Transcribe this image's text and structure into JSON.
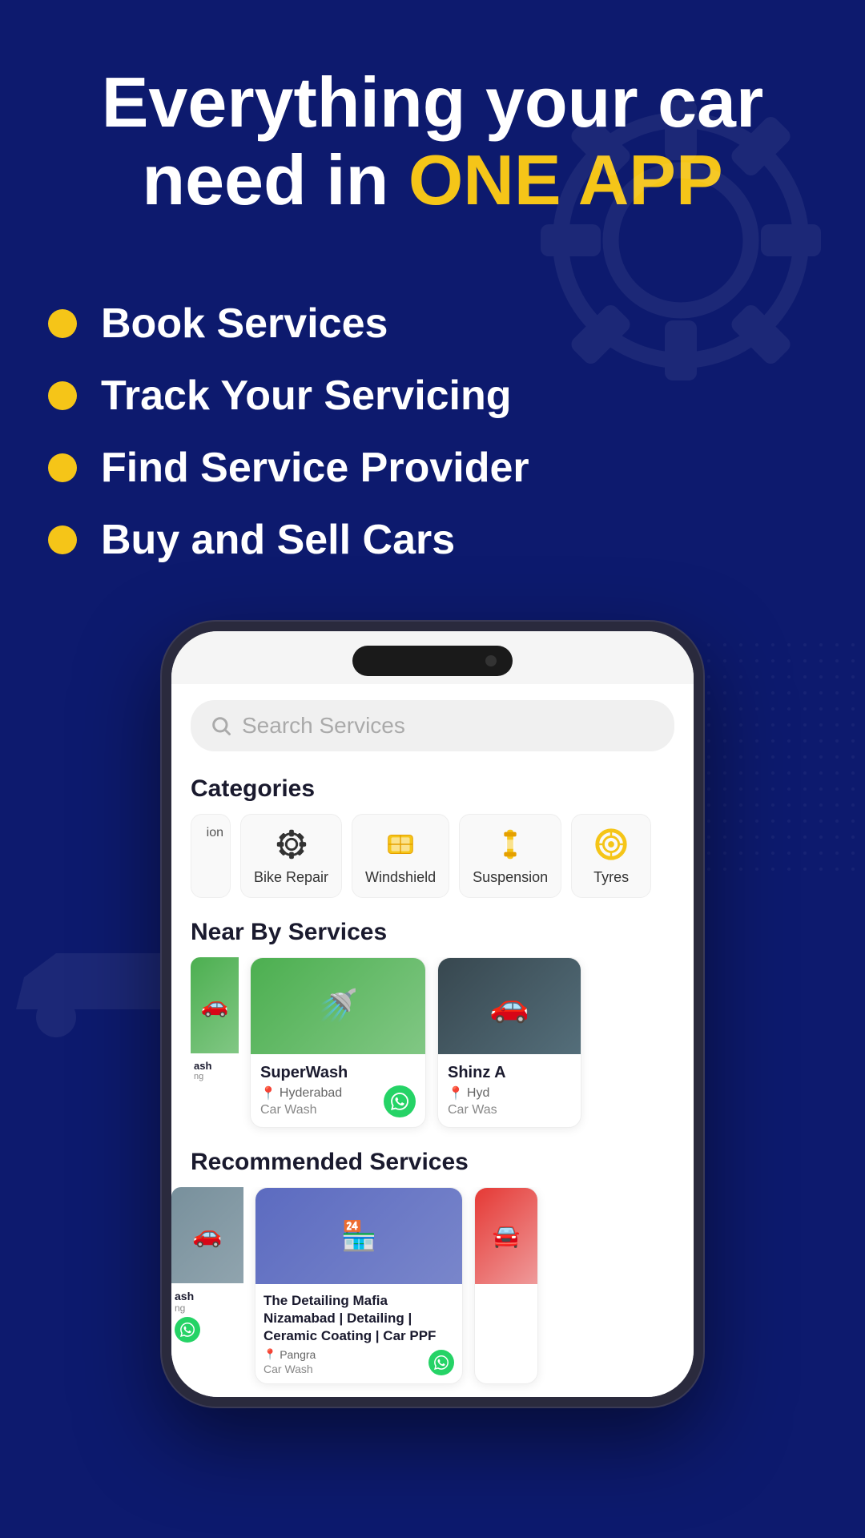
{
  "background": {
    "color": "#0d1a6e"
  },
  "hero": {
    "title_line1": "Everything your car",
    "title_line2": "need in ",
    "title_highlight": "ONE APP",
    "features": [
      "Book Services",
      "Track Your Servicing",
      "Find Service Provider",
      "Buy and Sell Cars"
    ]
  },
  "phone": {
    "screen": {
      "search": {
        "placeholder": "Search Services"
      },
      "categories": {
        "section_title": "Categories",
        "items": [
          {
            "label": "ion",
            "icon": "partial"
          },
          {
            "label": "Bike Repair",
            "icon": "gear"
          },
          {
            "label": "Windshield",
            "icon": "windshield"
          },
          {
            "label": "Suspension",
            "icon": "suspension"
          },
          {
            "label": "Tyres",
            "icon": "tyre"
          }
        ]
      },
      "nearby": {
        "section_title": "Near By Services",
        "items": [
          {
            "name": "SuperWash",
            "location": "Hyderabad",
            "type": "Car Wash",
            "img_bg": "green"
          },
          {
            "name": "Shinz A",
            "location": "Hyd",
            "type": "Car Was",
            "img_bg": "dark"
          }
        ]
      },
      "recommended": {
        "section_title": "Recommended Services",
        "items": [
          {
            "name": "ash",
            "subname": "ng",
            "img_bg": "partial-left"
          },
          {
            "name": "The Detailing Mafia Nizamabad | Detailing | Ceramic Coating | Car PPF",
            "location": "Pangra",
            "type": "Car Wash",
            "img_bg": "store"
          },
          {
            "name": "",
            "img_bg": "red-partial"
          }
        ]
      }
    }
  }
}
